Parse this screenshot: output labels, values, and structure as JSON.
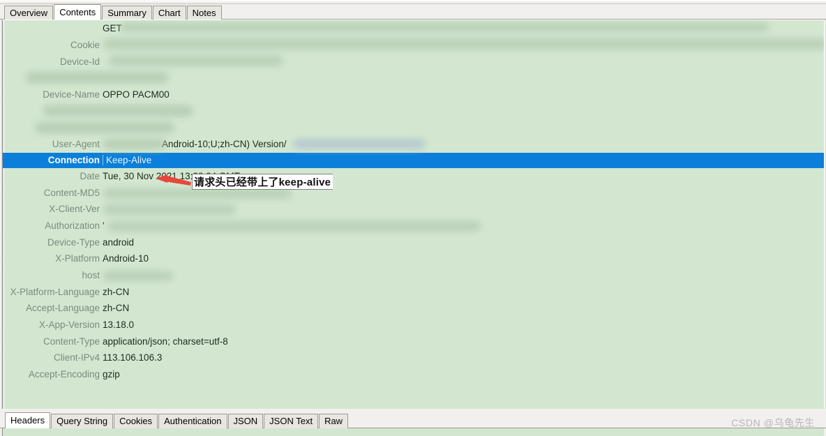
{
  "window": {
    "top_tabs": [
      {
        "label": "Overview",
        "active": false
      },
      {
        "label": "Contents",
        "active": true
      },
      {
        "label": "Summary",
        "active": false
      },
      {
        "label": "Chart",
        "active": false
      },
      {
        "label": "Notes",
        "active": false
      }
    ],
    "bottom_tabs": [
      {
        "label": "Headers",
        "active": true
      },
      {
        "label": "Query String",
        "active": false
      },
      {
        "label": "Cookies",
        "active": false
      },
      {
        "label": "Authentication",
        "active": false
      },
      {
        "label": "JSON",
        "active": false
      },
      {
        "label": "JSON Text",
        "active": false
      },
      {
        "label": "Raw",
        "active": false
      }
    ]
  },
  "colors": {
    "pane_background": "#d3e7d0",
    "selection_blue": "#0b7fda",
    "label_gray": "#7a8a7d",
    "annotation_red": "#e8453c",
    "watermark_gray": "#b7b7b7"
  },
  "headers": [
    {
      "label": "",
      "value": "GET ",
      "redacted": true
    },
    {
      "label": "Cookie",
      "value": "",
      "redacted": true
    },
    {
      "label": "Device-Id",
      "value": "",
      "redacted": true
    },
    {
      "label": "",
      "value": "",
      "redacted": true
    },
    {
      "label": "Device-Name",
      "value": "OPPO PACM00",
      "redacted": false
    },
    {
      "label": "",
      "value": "",
      "redacted": true
    },
    {
      "label": "",
      "value": "",
      "redacted": true
    },
    {
      "label": "User-Agent",
      "value": "Android-10;U;zh-CN) Version/",
      "redacted": true
    },
    {
      "label": "Connection",
      "value": "Keep-Alive",
      "redacted": false,
      "selected": true
    },
    {
      "label": "Date",
      "value": "Tue, 30 Nov 2021 13:38:04 GMT",
      "redacted": false
    },
    {
      "label": "Content-MD5",
      "value": "",
      "redacted": true
    },
    {
      "label": "X-Client-Ver",
      "value": "",
      "redacted": true
    },
    {
      "label": "Authorization",
      "value": "'",
      "redacted": true
    },
    {
      "label": "Device-Type",
      "value": "android",
      "redacted": false
    },
    {
      "label": "X-Platform",
      "value": "Android-10",
      "redacted": false
    },
    {
      "label": "host",
      "value": "",
      "redacted": true
    },
    {
      "label": "X-Platform-Language",
      "value": "zh-CN",
      "redacted": false
    },
    {
      "label": "Accept-Language",
      "value": "zh-CN",
      "redacted": false
    },
    {
      "label": "X-App-Version",
      "value": "13.18.0",
      "redacted": false
    },
    {
      "label": "Content-Type",
      "value": "application/json; charset=utf-8",
      "redacted": false
    },
    {
      "label": "Client-IPv4",
      "value": "113.106.106.3",
      "redacted": false
    },
    {
      "label": "Accept-Encoding",
      "value": "gzip",
      "redacted": false
    }
  ],
  "annotation": {
    "text": "请求头已经带上了keep-alive",
    "arrow": "left-pointing-arrow"
  },
  "watermark": {
    "text": "CSDN @乌龟先生"
  }
}
